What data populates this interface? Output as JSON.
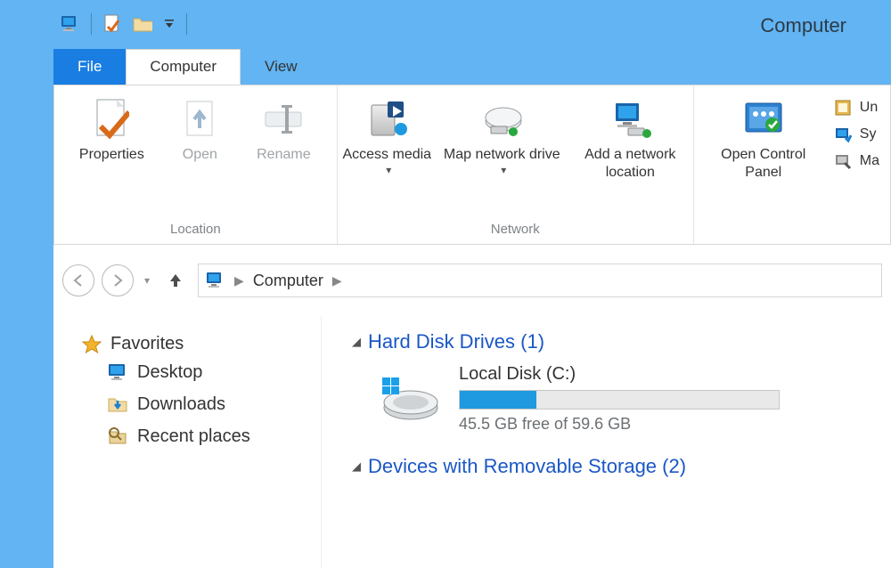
{
  "window_title": "Computer",
  "tabs": {
    "file": "File",
    "computer": "Computer",
    "view": "View"
  },
  "ribbon": {
    "location": {
      "title": "Location",
      "properties": "Properties",
      "open": "Open",
      "rename": "Rename"
    },
    "network": {
      "title": "Network",
      "access_media": "Access media",
      "map_network_drive": "Map network drive",
      "add_network_location": "Add a network location"
    },
    "system": {
      "open_control_panel": "Open Control Panel",
      "uninstall": "Un",
      "system_properties": "Sy",
      "manage": "Ma"
    }
  },
  "breadcrumb": {
    "root": "Computer"
  },
  "sidebar": {
    "favorites_header": "Favorites",
    "items": [
      {
        "label": "Desktop"
      },
      {
        "label": "Downloads"
      },
      {
        "label": "Recent places"
      }
    ]
  },
  "categories": {
    "hdd": {
      "label": "Hard Disk Drives",
      "count": 1
    },
    "removable": {
      "label": "Devices with Removable Storage",
      "count": 2
    }
  },
  "drives": {
    "local_c": {
      "name": "Local Disk (C:)",
      "free_gb": 45.5,
      "total_gb": 59.6,
      "display_free": "45.5 GB free of 59.6 GB",
      "used_percent": 24
    }
  }
}
